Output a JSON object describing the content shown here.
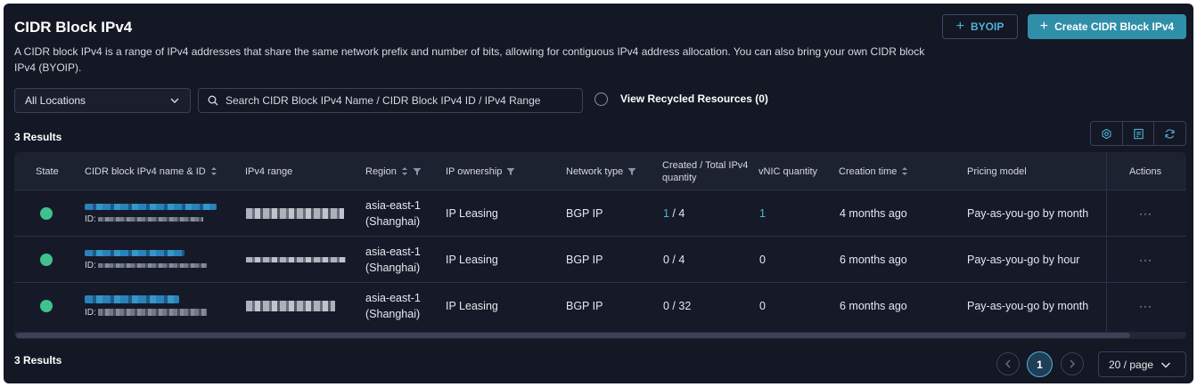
{
  "page": {
    "title": "CIDR Block IPv4",
    "description": "A CIDR block IPv4 is a range of IPv4 addresses that share the same network prefix and number of bits, allowing for contiguous IPv4 address allocation. You can also bring your own CIDR block IPv4 (BYOIP)."
  },
  "buttons": {
    "byoip": "BYOIP",
    "create": "Create CIDR Block IPv4"
  },
  "filters": {
    "location": "All Locations",
    "search_placeholder": "Search CIDR Block IPv4 Name / CIDR Block IPv4 ID / IPv4 Range",
    "recycled_label": "View Recycled Resources (0)"
  },
  "results_count": "3 Results",
  "table": {
    "headers": {
      "state": "State",
      "name": "CIDR block IPv4 name & ID",
      "range": "IPv4 range",
      "region": "Region",
      "ownership": "IP ownership",
      "network": "Network type",
      "quantity": "Created / Total IPv4 quantity",
      "vnic": "vNIC quantity",
      "created": "Creation time",
      "pricing": "Pricing model",
      "actions": "Actions"
    },
    "rows": [
      {
        "id_prefix": "ID:",
        "region_1": "asia-east-1",
        "region_2": "(Shanghai)",
        "ownership": "IP Leasing",
        "network": "BGP IP",
        "qty_created": "1",
        "qty_total": " / 4",
        "vnic": "1",
        "created": "4 months ago",
        "pricing": "Pay-as-you-go by month",
        "actions": "···"
      },
      {
        "id_prefix": "ID:",
        "region_1": "asia-east-1",
        "region_2": "(Shanghai)",
        "ownership": "IP Leasing",
        "network": "BGP IP",
        "qty_created": "0",
        "qty_total": " / 4",
        "vnic": "0",
        "created": "6 months ago",
        "pricing": "Pay-as-you-go by hour",
        "actions": "···"
      },
      {
        "id_prefix": "ID:",
        "region_1": "asia-east-1",
        "region_2": "(Shanghai)",
        "ownership": "IP Leasing",
        "network": "BGP IP",
        "qty_created": "0",
        "qty_total": " / 32",
        "vnic": "0",
        "created": "6 months ago",
        "pricing": "Pay-as-you-go by month",
        "actions": "···"
      }
    ]
  },
  "pagination": {
    "current": "1",
    "page_size": "20 / page"
  },
  "colors": {
    "accent": "#4fb3d9",
    "primary_button": "#2f8fa9",
    "status_ok": "#3fc28e",
    "background": "#141724"
  },
  "icons": [
    "plus-icon",
    "chevron-down-icon",
    "search-icon",
    "settings-icon",
    "export-icon",
    "refresh-icon",
    "sort-icon",
    "filter-icon",
    "chevron-left-icon",
    "chevron-right-icon"
  ]
}
